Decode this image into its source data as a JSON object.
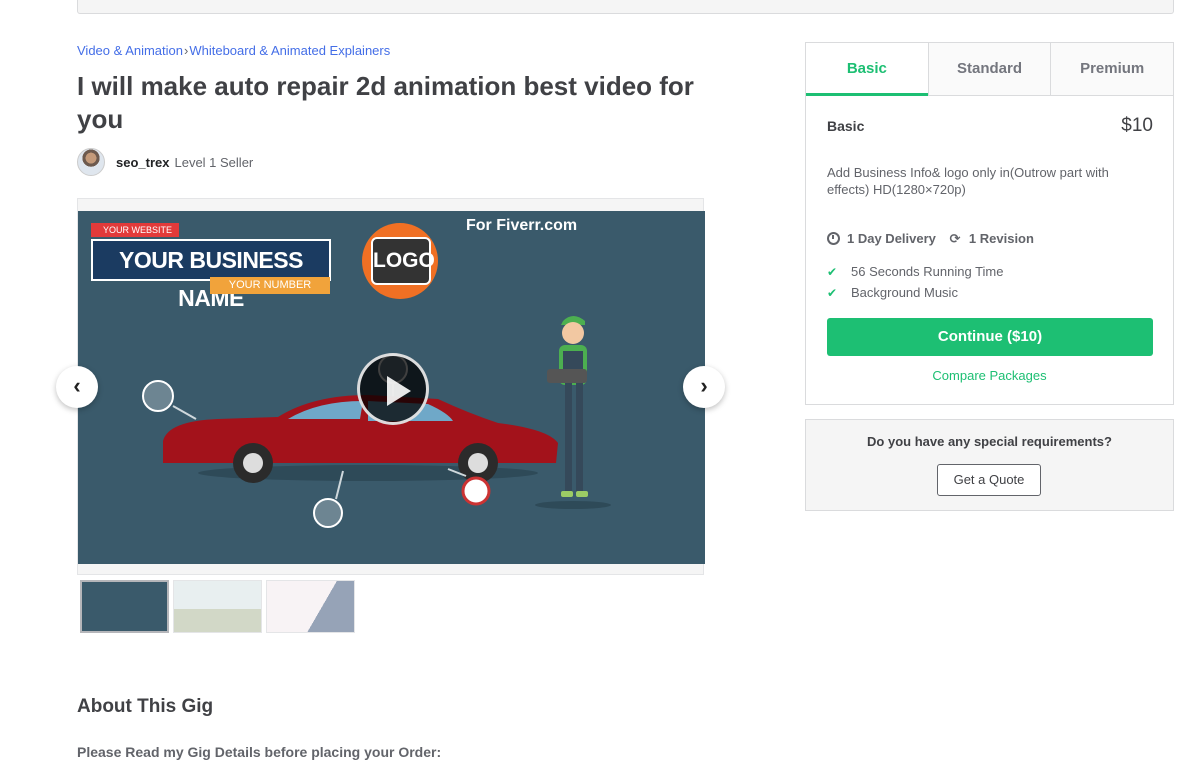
{
  "breadcrumb": {
    "category": "Video & Animation",
    "separator": "›",
    "subcategory": "Whiteboard & Animated Explainers"
  },
  "gig": {
    "title": "I will make auto repair 2d animation best video for you"
  },
  "seller": {
    "username": "seo_trex",
    "level": "Level 1 Seller"
  },
  "video": {
    "website_label": "YOUR WEBSITE",
    "business_name": "YOUR BUSINESS NAME",
    "number_label": "YOUR NUMBER",
    "logo_text": "LOGO",
    "watermark": "For Fiverr.com"
  },
  "carousel": {
    "prev_icon": "‹",
    "next_icon": "›"
  },
  "about": {
    "heading": "About This Gig",
    "intro": "Please Read my Gig Details before placing your Order:"
  },
  "packages": {
    "tabs": [
      {
        "label": "Basic",
        "active": true
      },
      {
        "label": "Standard",
        "active": false
      },
      {
        "label": "Premium",
        "active": false
      }
    ],
    "selected": {
      "name": "Basic",
      "price": "$10",
      "description": "Add Business Info& logo only in(Outrow part with effects) HD(1280×720p)",
      "delivery": "1 Day Delivery",
      "revisions": "1 Revision",
      "features": [
        "56 Seconds Running Time",
        "Background Music"
      ]
    },
    "continue_label": "Continue ($10)",
    "compare_label": "Compare Packages"
  },
  "quote": {
    "question": "Do you have any special requirements?",
    "button_label": "Get a Quote"
  },
  "colors": {
    "accent": "#1dbf73",
    "link": "#446ee7",
    "text": "#404145"
  }
}
